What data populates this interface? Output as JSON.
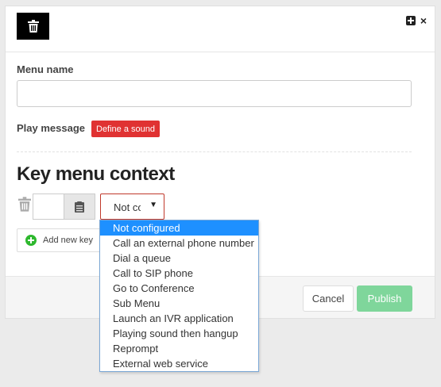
{
  "header": {
    "delete_icon": "trash-icon",
    "expand_icon": "plus-square-icon",
    "close_icon": "close-icon",
    "close_glyph": "×"
  },
  "form": {
    "menu_name_label": "Menu name",
    "menu_name_value": "",
    "play_message_label": "Play message",
    "define_sound_label": "Define a sound"
  },
  "key_menu": {
    "title": "Key menu context",
    "key_value": "",
    "action_value": "Not co",
    "add_key_label": "Add new key"
  },
  "dropdown": {
    "options": [
      "Not configured",
      "Call an external phone number",
      "Dial a queue",
      "Call to SIP phone",
      "Go to Conference",
      "Sub Menu",
      "Launch an IVR application",
      "Playing sound then hangup",
      "Reprompt",
      "External web service"
    ],
    "selected_index": 0
  },
  "footer": {
    "cancel_label": "Cancel",
    "publish_label": "Publish"
  },
  "colors": {
    "danger": "#e03232",
    "publish": "#7fd69b",
    "highlight": "#1e90ff",
    "add_icon": "#2eb82e"
  }
}
